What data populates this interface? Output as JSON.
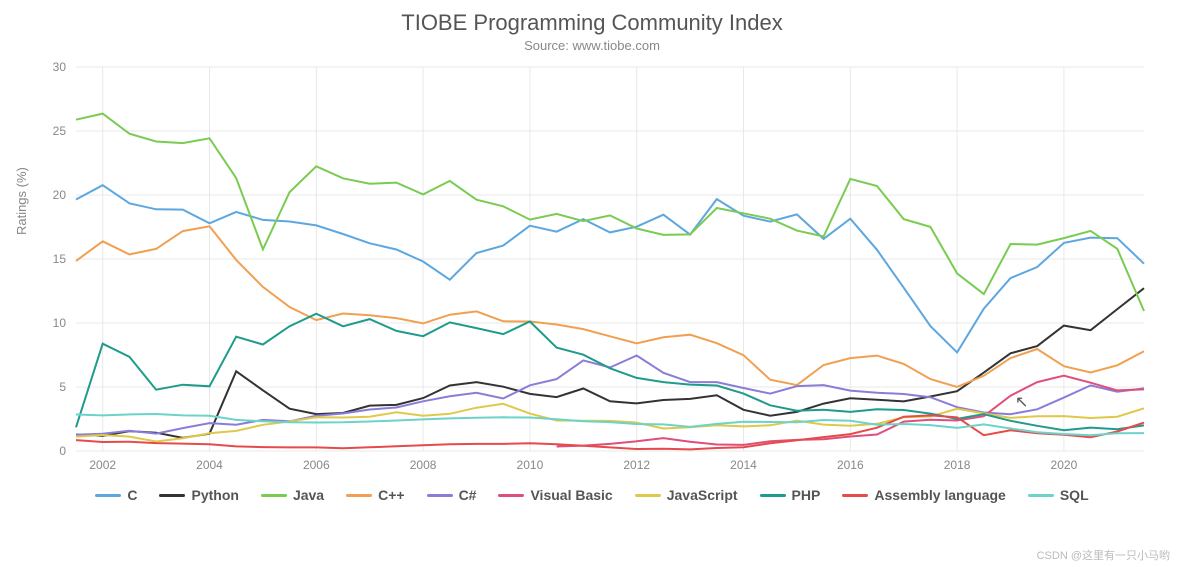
{
  "watermark": "CSDN @这里有一只小马哟",
  "chart_data": {
    "type": "line",
    "title": "TIOBE Programming Community Index",
    "subtitle": "Source: www.tiobe.com",
    "ylabel": "Ratings (%)",
    "xlabel": "",
    "xlim": [
      2001.5,
      2021.5
    ],
    "ylim": [
      0,
      30
    ],
    "yticks": [
      0,
      5,
      10,
      15,
      20,
      25,
      30
    ],
    "xticks": [
      2002,
      2004,
      2006,
      2008,
      2010,
      2012,
      2014,
      2016,
      2018,
      2020
    ],
    "x": [
      2001.5,
      2002,
      2002.5,
      2003,
      2003.5,
      2004,
      2004.5,
      2005,
      2005.5,
      2006,
      2006.5,
      2007,
      2007.5,
      2008,
      2008.5,
      2009,
      2009.5,
      2010,
      2010.5,
      2011,
      2011.5,
      2012,
      2012.5,
      2013,
      2013.5,
      2014,
      2014.5,
      2015,
      2015.5,
      2016,
      2016.5,
      2017,
      2017.5,
      2018,
      2018.5,
      2019,
      2019.5,
      2020,
      2020.5,
      2021,
      2021.5
    ],
    "series": [
      {
        "name": "C",
        "color": "#5da7e0",
        "values": [
          19.5,
          20.5,
          19.0,
          18.5,
          18.5,
          17.5,
          18.5,
          18.0,
          18.0,
          17.8,
          17.2,
          16.5,
          16.0,
          15.0,
          13.5,
          15.5,
          16.0,
          17.5,
          17.0,
          18.0,
          17.0,
          17.5,
          18.5,
          17.0,
          19.8,
          18.5,
          18.0,
          18.5,
          16.5,
          18.0,
          15.5,
          12.5,
          9.5,
          7.5,
          11.0,
          13.5,
          14.5,
          16.5,
          17.0,
          17.0,
          15.0
        ]
      },
      {
        "name": "Python",
        "color": "#333333",
        "values": [
          1.0,
          1.0,
          1.5,
          1.5,
          1.2,
          1.6,
          6.5,
          5.0,
          3.5,
          3.0,
          3.0,
          3.5,
          3.5,
          4.0,
          5.0,
          5.3,
          5.0,
          4.5,
          4.3,
          5.0,
          4.0,
          3.8,
          4.0,
          4.0,
          4.2,
          3.0,
          2.5,
          2.8,
          3.5,
          4.0,
          4.0,
          4.0,
          4.5,
          5.0,
          6.5,
          8.0,
          8.5,
          10.0,
          9.5,
          11.0,
          12.5
        ]
      },
      {
        "name": "Java",
        "color": "#7acb52",
        "values": [
          25.5,
          26.0,
          24.5,
          24.0,
          24.0,
          24.5,
          21.5,
          16.0,
          20.5,
          22.5,
          21.5,
          21.0,
          21.0,
          20.0,
          21.0,
          19.5,
          19.0,
          18.0,
          18.5,
          18.0,
          18.5,
          17.5,
          17.0,
          17.0,
          19.0,
          18.5,
          18.0,
          17.0,
          16.5,
          21.0,
          20.5,
          18.0,
          17.5,
          14.0,
          12.5,
          16.5,
          16.5,
          17.0,
          17.5,
          16.0,
          11.0
        ]
      },
      {
        "name": "C++",
        "color": "#f0a050",
        "values": [
          14.5,
          16.0,
          15.0,
          15.5,
          17.0,
          17.5,
          15.0,
          13.0,
          11.5,
          10.5,
          11.0,
          10.8,
          10.5,
          10.0,
          10.6,
          10.8,
          10.0,
          10.0,
          9.8,
          9.5,
          9.0,
          8.5,
          9.0,
          9.2,
          8.5,
          7.5,
          5.5,
          5.0,
          6.5,
          7.0,
          7.2,
          6.6,
          5.5,
          5.0,
          6.0,
          7.5,
          8.3,
          7.0,
          6.5,
          7.0,
          8.0
        ]
      },
      {
        "name": "C#",
        "color": "#8a7dd8",
        "values": [
          1.0,
          1.0,
          1.2,
          1.0,
          1.5,
          2.0,
          2.0,
          2.5,
          2.5,
          3.0,
          3.2,
          3.5,
          3.6,
          4.0,
          4.3,
          4.5,
          4.0,
          5.0,
          5.5,
          7.0,
          6.5,
          7.5,
          6.2,
          5.5,
          5.5,
          5.0,
          4.5,
          5.0,
          5.0,
          4.5,
          4.3,
          4.2,
          4.0,
          3.3,
          3.0,
          3.0,
          3.5,
          4.5,
          5.5,
          5.0,
          5.2
        ]
      },
      {
        "name": "Visual Basic",
        "color": "#e04f7b",
        "values": [
          null,
          null,
          null,
          null,
          null,
          null,
          null,
          null,
          null,
          null,
          null,
          null,
          null,
          null,
          null,
          null,
          null,
          null,
          0.2,
          0.2,
          0.3,
          0.5,
          0.8,
          0.6,
          0.5,
          0.6,
          1.0,
          1.2,
          1.3,
          1.5,
          1.6,
          2.5,
          2.5,
          2.3,
          2.5,
          4.0,
          5.0,
          5.5,
          5.0,
          4.5,
          4.7
        ]
      },
      {
        "name": "JavaScript",
        "color": "#e0c84a",
        "values": [
          1.3,
          1.5,
          1.4,
          1.0,
          1.2,
          1.5,
          1.6,
          2.0,
          2.2,
          2.5,
          2.5,
          2.6,
          3.0,
          2.8,
          3.0,
          3.5,
          3.8,
          3.0,
          2.4,
          2.3,
          2.2,
          2.0,
          1.5,
          1.6,
          1.8,
          1.8,
          2.0,
          2.5,
          2.3,
          2.3,
          2.5,
          3.0,
          3.0,
          3.5,
          3.0,
          2.5,
          2.5,
          2.4,
          2.2,
          2.3,
          3.0
        ]
      },
      {
        "name": "PHP",
        "color": "#1f9b8a",
        "values": [
          1.5,
          8.0,
          7.0,
          4.5,
          5.0,
          5.0,
          9.0,
          8.5,
          10.0,
          11.0,
          10.0,
          10.5,
          9.5,
          9.0,
          10.0,
          9.5,
          9.0,
          10.0,
          8.0,
          7.5,
          6.5,
          5.8,
          5.5,
          5.3,
          5.2,
          4.5,
          3.5,
          3.0,
          3.0,
          2.8,
          3.0,
          3.0,
          2.8,
          2.5,
          3.0,
          2.6,
          2.3,
          2.0,
          2.2,
          2.0,
          2.2
        ]
      },
      {
        "name": "Assembly language",
        "color": "#e54b4b",
        "values": [
          0.8,
          0.6,
          0.6,
          0.5,
          0.5,
          0.5,
          0.4,
          0.4,
          0.4,
          0.4,
          0.3,
          0.3,
          0.3,
          0.3,
          0.3,
          0.3,
          0.3,
          0.4,
          0.4,
          0.4,
          0.4,
          0.4,
          0.5,
          0.5,
          0.6,
          0.6,
          0.8,
          0.9,
          1.0,
          1.1,
          1.5,
          2.3,
          2.4,
          2.3,
          1.0,
          1.5,
          1.4,
          1.4,
          1.3,
          1.8,
          2.5
        ]
      },
      {
        "name": "SQL",
        "color": "#6cd3c9",
        "values": [
          2.5,
          2.4,
          2.5,
          2.6,
          2.6,
          2.7,
          2.5,
          2.5,
          2.5,
          2.5,
          2.5,
          2.5,
          2.5,
          2.5,
          2.5,
          2.5,
          2.5,
          2.5,
          2.4,
          2.3,
          2.3,
          2.2,
          2.2,
          2.0,
          2.2,
          2.3,
          2.2,
          2.1,
          2.2,
          2.1,
          1.8,
          1.9,
          1.9,
          1.8,
          2.2,
          2.0,
          1.8,
          1.7,
          1.6,
          1.7,
          1.6
        ]
      }
    ]
  }
}
